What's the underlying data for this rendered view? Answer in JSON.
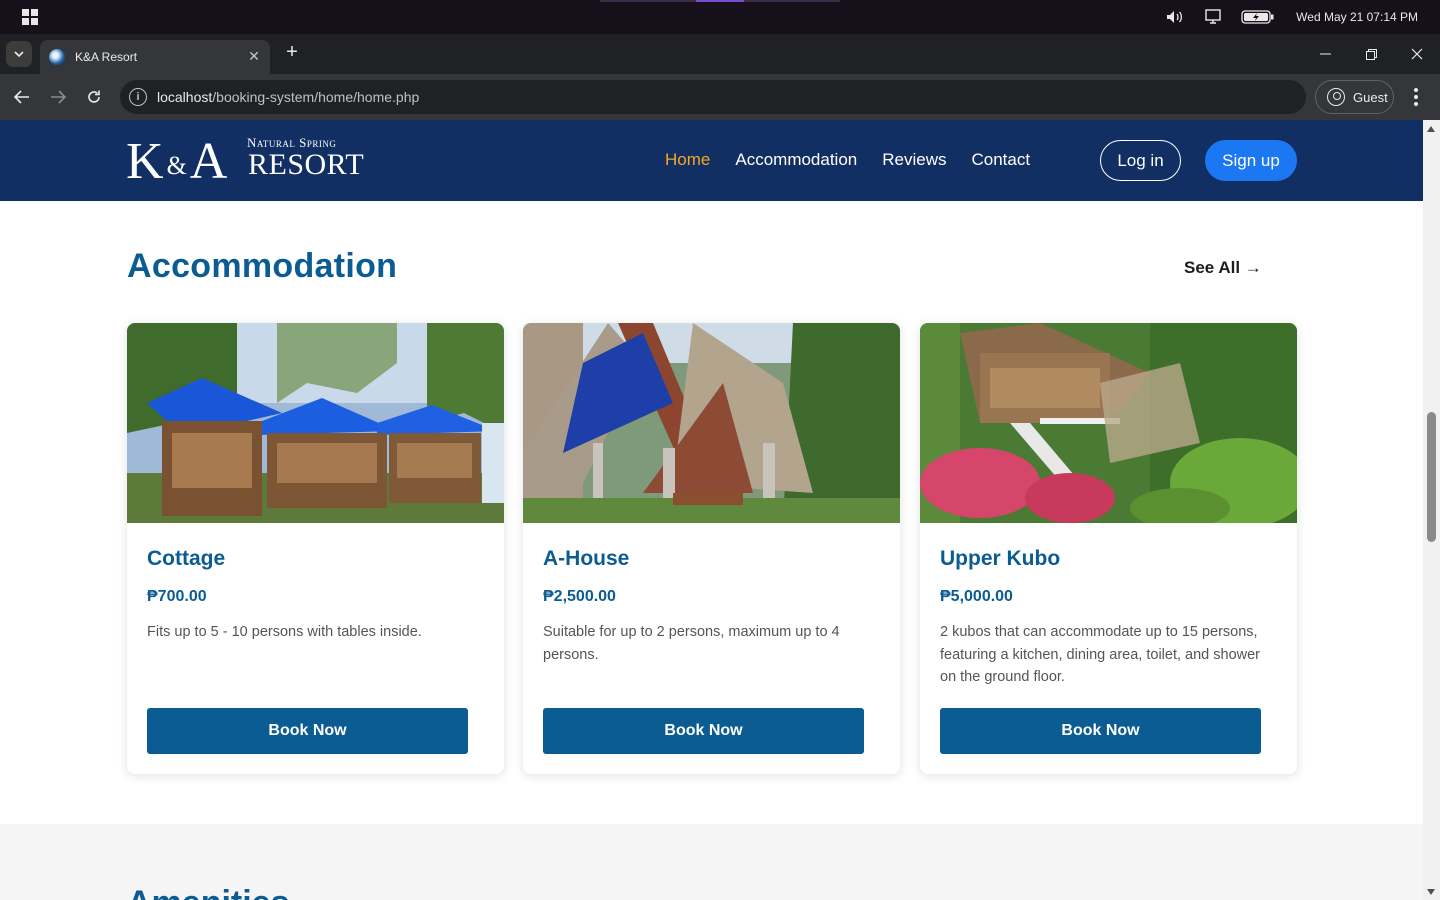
{
  "os": {
    "datetime": "Wed May 21  07:14 PM",
    "icons": [
      "windows-icon",
      "volume-icon",
      "display-icon",
      "battery-icon"
    ]
  },
  "browser": {
    "tab_title": "K&A Resort",
    "url_host": "localhost",
    "url_path": "/booking-system/home/home.php",
    "profile_label": "Guest"
  },
  "header": {
    "logo_monogram_a": "K",
    "logo_monogram_amp": "&",
    "logo_monogram_b": "A",
    "logo_subtitle": "Natural Spring",
    "logo_title": "RESORT",
    "menu": [
      {
        "label": "Home",
        "active": true
      },
      {
        "label": "Accommodation"
      },
      {
        "label": "Reviews"
      },
      {
        "label": "Contact"
      }
    ],
    "login_label": "Log in",
    "signup_label": "Sign up"
  },
  "accommodation": {
    "title": "Accommodation",
    "see_all": "See All →",
    "cards": [
      {
        "name": "Cottage",
        "price": "₱700.00",
        "description": "Fits up to 5 - 10 persons with tables inside.",
        "button": "Book Now"
      },
      {
        "name": "A-House",
        "price": "₱2,500.00",
        "description": "Suitable for up to 2 persons, maximum up to 4 persons.",
        "button": "Book Now"
      },
      {
        "name": "Upper Kubo",
        "price": "₱5,000.00",
        "description": "2 kubos that can accommodate up to 15 persons, featuring a kitchen, dining area, toilet, and shower on the ground floor.",
        "button": "Book Now"
      }
    ]
  },
  "amenities": {
    "title": "Amenities"
  },
  "colors": {
    "header_bg": "#112f63",
    "primary": "#0c5c94",
    "active_nav": "#f5a52a",
    "signup_bg": "#1c78f2"
  }
}
